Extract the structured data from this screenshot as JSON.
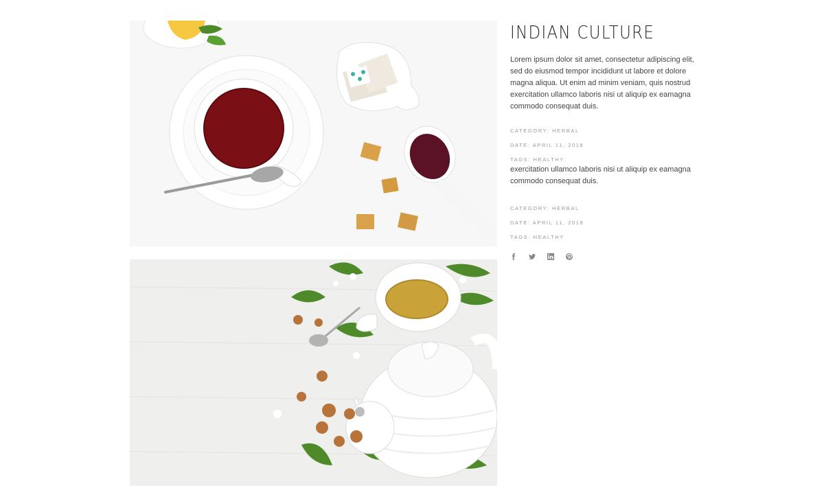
{
  "post": {
    "title": "INDIAN CULTURE",
    "paragraph_1": "Lorem ipsum dolor sit amet, consectetur adipiscing elit, sed do eiusmod tempor incididunt ut labore et dolore magna aliqua. Ut enim ad minim veniam, quis nostrud exercitation ullamco laboris nisi ut aliquip ex eamagna commodo consequat duis.",
    "meta_group_1": {
      "category": "CATEGORY: HERBAL",
      "date": "DATE: APRIL 11, 2018",
      "tags": "TAGS: HEALTHY"
    },
    "paragraph_2": "exercitation ullamco laboris nisi ut aliquip ex eamagna commodo consequat duis.",
    "meta_group_2": {
      "category": "CATEGORY: HERBAL",
      "date": "DATE: APRIL 11, 2018",
      "tags": "TAGS: HEALTHY"
    }
  },
  "social": [
    {
      "icon": "facebook-icon"
    },
    {
      "icon": "twitter-icon"
    },
    {
      "icon": "linkedin-icon"
    },
    {
      "icon": "pinterest-icon"
    }
  ],
  "colors": {
    "tea_red": "#7a0f16",
    "tea_green": "#c9a23a",
    "leaf": "#4e8a2a",
    "sugar": "#d9a24a"
  }
}
